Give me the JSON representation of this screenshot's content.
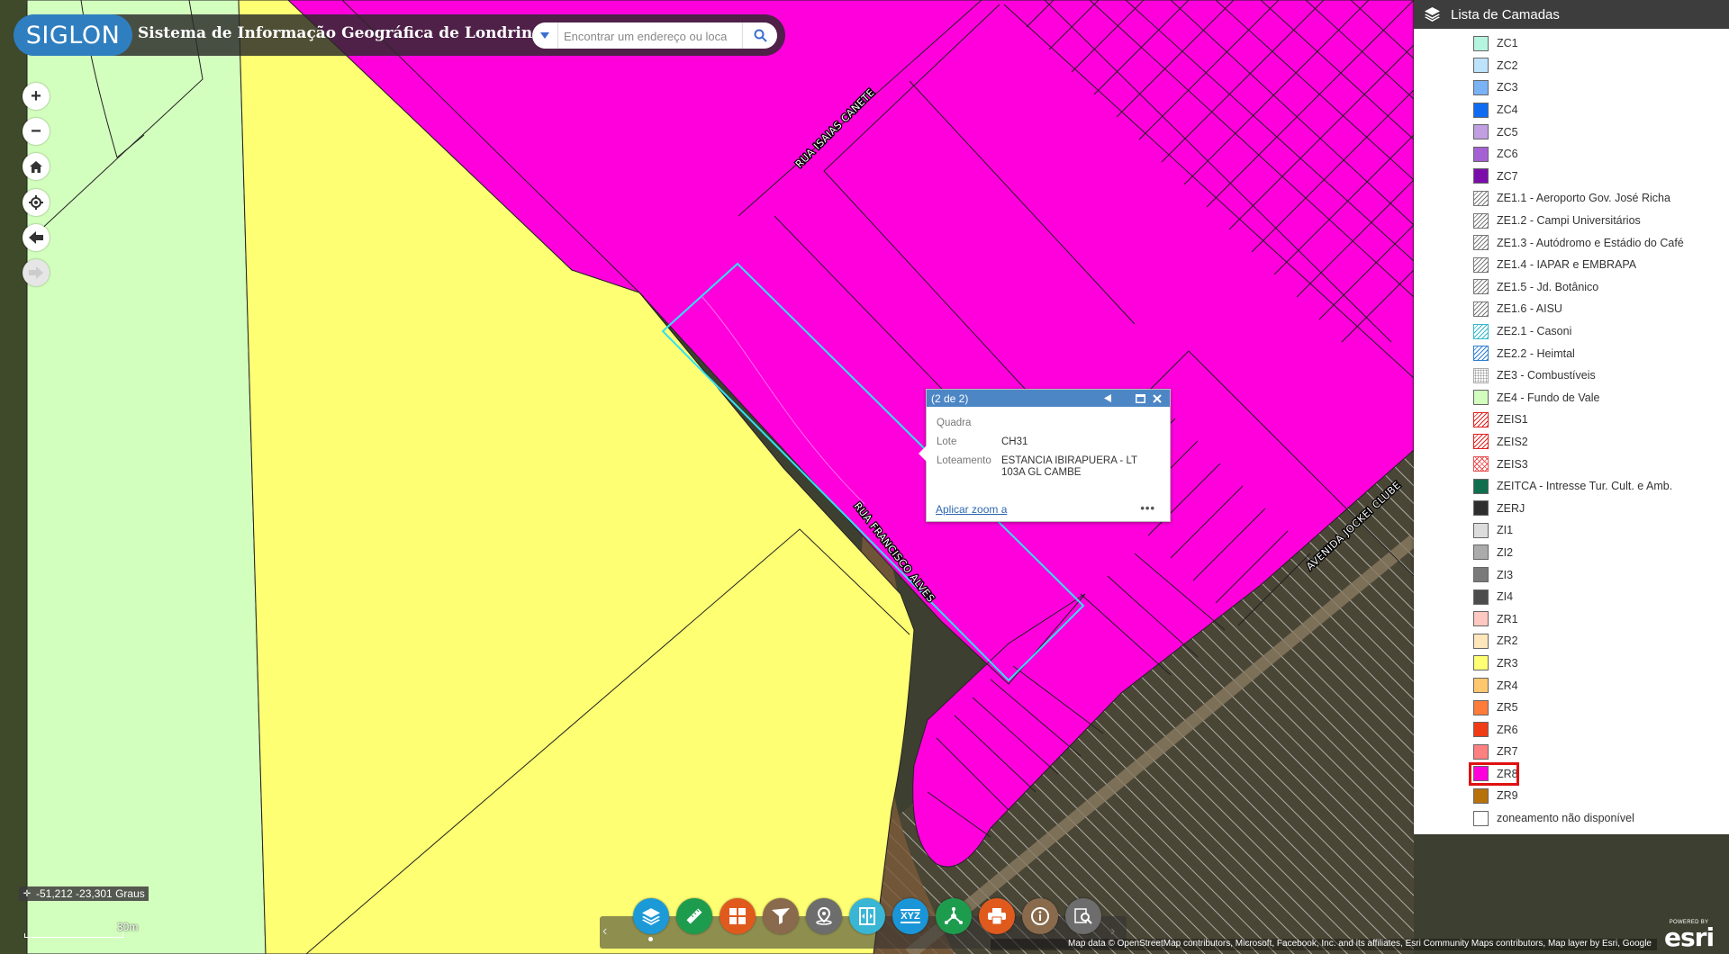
{
  "app": {
    "logo_text": "SIGLON",
    "title": "Sistema de Informação Geográfica de Londrina"
  },
  "search": {
    "placeholder": "Encontrar um endereço ou loca"
  },
  "map": {
    "streets": [
      "RUA ISAIAS CANETE",
      "RUA FRANCISCO ALVES",
      "AVENIDA JOCKEI CLUBE"
    ],
    "colors": {
      "zr8": "#ff00dd",
      "zr3": "#ffff73",
      "ze4": "#d3ffbe",
      "selection": "#32e1f0"
    },
    "coordinates": "-51,212 -23,301 Graus",
    "scale": "30m",
    "attribution": "Map data © OpenStreetMap contributors, Microsoft, Facebook, Inc. and its affiliates, Esri Community Maps contributors, Map layer by Esri, Google"
  },
  "layer_panel": {
    "title": "Lista de Camadas",
    "items": [
      {
        "label": "ZC1",
        "color": "#b5f5e0",
        "pattern": "solid"
      },
      {
        "label": "ZC2",
        "color": "#bde3fb",
        "pattern": "solid"
      },
      {
        "label": "ZC3",
        "color": "#79b2f5",
        "pattern": "solid"
      },
      {
        "label": "ZC4",
        "color": "#0f6cf2",
        "pattern": "solid"
      },
      {
        "label": "ZC5",
        "color": "#c0a0e0",
        "pattern": "solid"
      },
      {
        "label": "ZC6",
        "color": "#a561d4",
        "pattern": "solid"
      },
      {
        "label": "ZC7",
        "color": "#7b0dab",
        "pattern": "solid"
      },
      {
        "label": "ZE1.1 - Aeroporto Gov. José Richa",
        "color": "#777777",
        "pattern": "hatch"
      },
      {
        "label": "ZE1.2 - Campi Universitários",
        "color": "#777777",
        "pattern": "hatch"
      },
      {
        "label": "ZE1.3 - Autódromo e Estádio do Café",
        "color": "#777777",
        "pattern": "hatch"
      },
      {
        "label": "ZE1.4 - IAPAR e EMBRAPA",
        "color": "#777777",
        "pattern": "hatch"
      },
      {
        "label": "ZE1.5 - Jd. Botânico",
        "color": "#777777",
        "pattern": "hatch"
      },
      {
        "label": "ZE1.6 - AISU",
        "color": "#777777",
        "pattern": "hatch"
      },
      {
        "label": "ZE2.1 - Casoni",
        "color": "#35b8c8",
        "pattern": "hatch"
      },
      {
        "label": "ZE2.2 - Heimtal",
        "color": "#2c7fd0",
        "pattern": "hatch"
      },
      {
        "label": "ZE3 - Combustíveis",
        "color": "#999999",
        "pattern": "dots"
      },
      {
        "label": "ZE4 - Fundo de Vale",
        "color": "#d3ffbe",
        "pattern": "solid"
      },
      {
        "label": "ZEIS1",
        "color": "#e02020",
        "pattern": "hatch"
      },
      {
        "label": "ZEIS2",
        "color": "#e02020",
        "pattern": "hatch"
      },
      {
        "label": "ZEIS3",
        "color": "#e85050",
        "pattern": "cross"
      },
      {
        "label": "ZEITCA - Intresse Tur. Cult. e Amb.",
        "color": "#0f6e4e",
        "pattern": "solid"
      },
      {
        "label": "ZERJ",
        "color": "#2e2e2e",
        "pattern": "solid"
      },
      {
        "label": "ZI1",
        "color": "#dcdcdc",
        "pattern": "solid"
      },
      {
        "label": "ZI2",
        "color": "#ababab",
        "pattern": "solid"
      },
      {
        "label": "ZI3",
        "color": "#7a7a7a",
        "pattern": "solid"
      },
      {
        "label": "ZI4",
        "color": "#4c4c4c",
        "pattern": "solid"
      },
      {
        "label": "ZR1",
        "color": "#ffc8c0",
        "pattern": "solid"
      },
      {
        "label": "ZR2",
        "color": "#ffe6bb",
        "pattern": "solid"
      },
      {
        "label": "ZR3",
        "color": "#ffff73",
        "pattern": "solid"
      },
      {
        "label": "ZR4",
        "color": "#ffc86e",
        "pattern": "solid"
      },
      {
        "label": "ZR5",
        "color": "#ff7b3a",
        "pattern": "solid"
      },
      {
        "label": "ZR6",
        "color": "#f03c14",
        "pattern": "solid"
      },
      {
        "label": "ZR7",
        "color": "#ff8080",
        "pattern": "solid"
      },
      {
        "label": "ZR8",
        "color": "#ff00dd",
        "pattern": "solid",
        "highlight": true
      },
      {
        "label": "ZR9",
        "color": "#b8720a",
        "pattern": "solid"
      },
      {
        "label": "zoneamento não disponível",
        "color": "#ffffff",
        "pattern": "solid"
      }
    ]
  },
  "popup": {
    "counter": "(2 de 2)",
    "fields": [
      {
        "name": "Quadra",
        "value": ""
      },
      {
        "name": "Lote",
        "value": "CH31"
      },
      {
        "name": "Loteamento",
        "value": "ESTANCIA IBIRAPUERA - LT 103A GL CAMBE"
      }
    ],
    "zoom_link": "Aplicar zoom a",
    "more": "•••"
  },
  "toolbar": {
    "buttons": [
      {
        "name": "layers-icon",
        "color": "#1c9ad8"
      },
      {
        "name": "measure-icon",
        "color": "#1e9c4e"
      },
      {
        "name": "basemap-gallery-icon",
        "color": "#e05a1e"
      },
      {
        "name": "filter-icon",
        "color": "#8a6a4c"
      },
      {
        "name": "location-pin-icon",
        "color": "#6d6d6d"
      },
      {
        "name": "swipe-icon",
        "color": "#38b6d4"
      },
      {
        "name": "xyz-icon",
        "color": "#1a96d8"
      },
      {
        "name": "share-icon",
        "color": "#1e9c4e"
      },
      {
        "name": "print-icon",
        "color": "#e05a1e"
      },
      {
        "name": "info-icon",
        "color": "#8a6a4c"
      },
      {
        "name": "query-icon",
        "color": "#6d6d6d"
      }
    ],
    "xyz_label": "XYZ"
  },
  "esri": {
    "powered_by": "POWERED BY",
    "brand": "esri"
  }
}
